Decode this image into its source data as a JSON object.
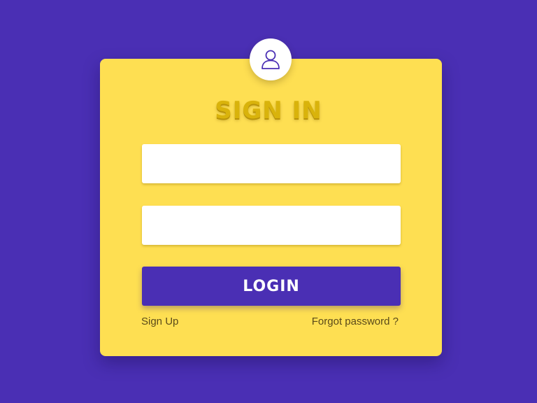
{
  "colors": {
    "background": "#4a2fb4",
    "card": "#fedf52",
    "title": "#d9b30b",
    "button": "#4a2fb4",
    "button_text": "#ffffff",
    "link_text": "#5a4a1a"
  },
  "avatar": {
    "icon": "user-icon"
  },
  "form": {
    "title": "SIGN IN",
    "username": {
      "value": "",
      "placeholder": ""
    },
    "password": {
      "value": "",
      "placeholder": ""
    },
    "login_label": "LOGIN",
    "signup_label": "Sign Up",
    "forgot_label": "Forgot password ?"
  }
}
